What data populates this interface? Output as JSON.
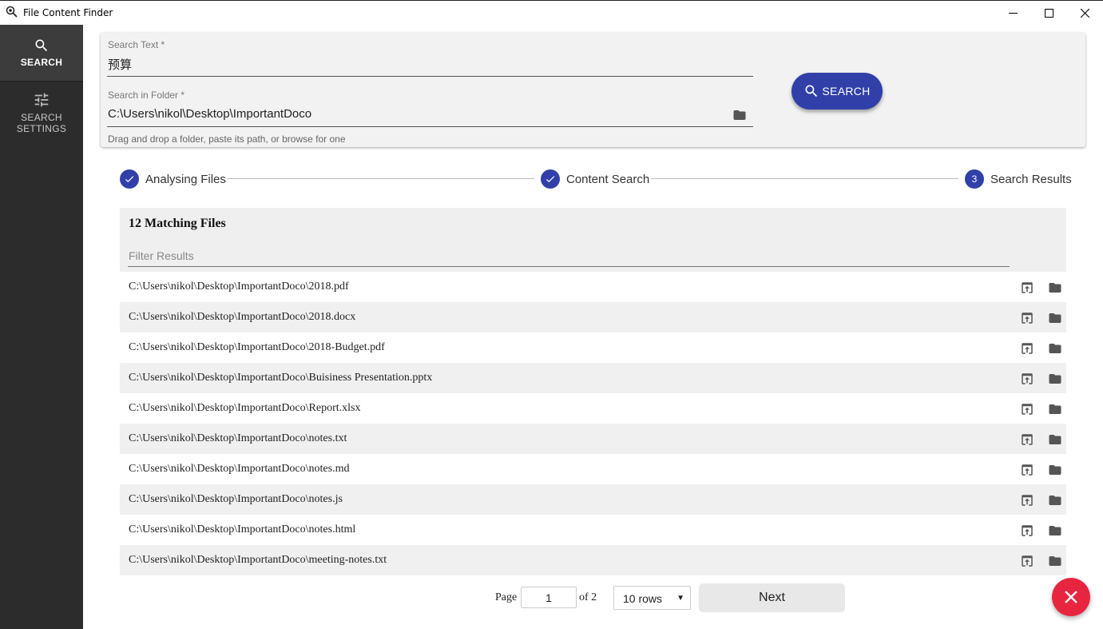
{
  "window": {
    "title": "File Content Finder"
  },
  "sidebar": {
    "items": [
      {
        "label": "SEARCH",
        "icon": "search-icon"
      },
      {
        "label": "SEARCH SETTINGS",
        "icon": "tune-icon"
      }
    ]
  },
  "search": {
    "text_label": "Search Text *",
    "text_value": "预算",
    "folder_label": "Search in Folder *",
    "folder_value": "C:\\Users\\nikol\\Desktop\\ImportantDoco",
    "folder_helper": "Drag and drop a folder, paste its path, or browse for one",
    "button_label": "SEARCH"
  },
  "stepper": {
    "steps": [
      {
        "label": "Analysing Files",
        "state": "done"
      },
      {
        "label": "Content Search",
        "state": "done"
      },
      {
        "label": "Search Results",
        "state": "active",
        "number": "3"
      }
    ]
  },
  "results": {
    "title": "12 Matching Files",
    "filter_placeholder": "Filter Results",
    "files": [
      "C:\\Users\\nikol\\Desktop\\ImportantDoco\\2018.pdf",
      "C:\\Users\\nikol\\Desktop\\ImportantDoco\\2018.docx",
      "C:\\Users\\nikol\\Desktop\\ImportantDoco\\2018-Budget.pdf",
      "C:\\Users\\nikol\\Desktop\\ImportantDoco\\Buisiness Presentation.pptx",
      "C:\\Users\\nikol\\Desktop\\ImportantDoco\\Report.xlsx",
      "C:\\Users\\nikol\\Desktop\\ImportantDoco\\notes.txt",
      "C:\\Users\\nikol\\Desktop\\ImportantDoco\\notes.md",
      "C:\\Users\\nikol\\Desktop\\ImportantDoco\\notes.js",
      "C:\\Users\\nikol\\Desktop\\ImportantDoco\\notes.html",
      "C:\\Users\\nikol\\Desktop\\ImportantDoco\\meeting-notes.txt"
    ]
  },
  "pagination": {
    "page_label": "Page",
    "page_value": "1",
    "of_label": "of 2",
    "rows_value": "10 rows",
    "next_label": "Next"
  },
  "colors": {
    "accent": "#3140a8",
    "fab": "#e8253f",
    "sidebar": "#2c2c2c"
  }
}
